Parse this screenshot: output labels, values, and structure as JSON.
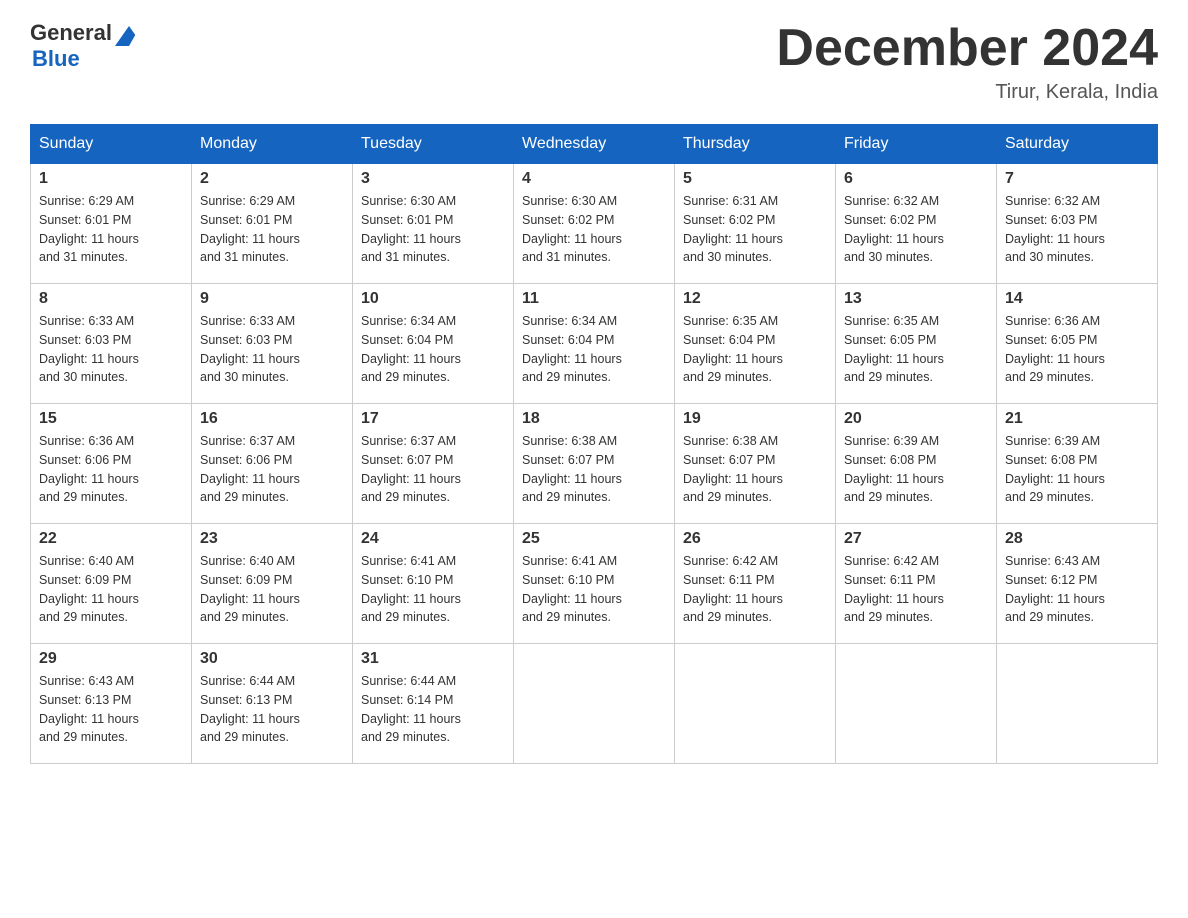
{
  "header": {
    "logo": {
      "general": "General",
      "blue": "Blue"
    },
    "title": "December 2024",
    "location": "Tirur, Kerala, India"
  },
  "days_of_week": [
    "Sunday",
    "Monday",
    "Tuesday",
    "Wednesday",
    "Thursday",
    "Friday",
    "Saturday"
  ],
  "weeks": [
    [
      {
        "day": "1",
        "sunrise": "6:29 AM",
        "sunset": "6:01 PM",
        "daylight": "11 hours and 31 minutes."
      },
      {
        "day": "2",
        "sunrise": "6:29 AM",
        "sunset": "6:01 PM",
        "daylight": "11 hours and 31 minutes."
      },
      {
        "day": "3",
        "sunrise": "6:30 AM",
        "sunset": "6:01 PM",
        "daylight": "11 hours and 31 minutes."
      },
      {
        "day": "4",
        "sunrise": "6:30 AM",
        "sunset": "6:02 PM",
        "daylight": "11 hours and 31 minutes."
      },
      {
        "day": "5",
        "sunrise": "6:31 AM",
        "sunset": "6:02 PM",
        "daylight": "11 hours and 30 minutes."
      },
      {
        "day": "6",
        "sunrise": "6:32 AM",
        "sunset": "6:02 PM",
        "daylight": "11 hours and 30 minutes."
      },
      {
        "day": "7",
        "sunrise": "6:32 AM",
        "sunset": "6:03 PM",
        "daylight": "11 hours and 30 minutes."
      }
    ],
    [
      {
        "day": "8",
        "sunrise": "6:33 AM",
        "sunset": "6:03 PM",
        "daylight": "11 hours and 30 minutes."
      },
      {
        "day": "9",
        "sunrise": "6:33 AM",
        "sunset": "6:03 PM",
        "daylight": "11 hours and 30 minutes."
      },
      {
        "day": "10",
        "sunrise": "6:34 AM",
        "sunset": "6:04 PM",
        "daylight": "11 hours and 29 minutes."
      },
      {
        "day": "11",
        "sunrise": "6:34 AM",
        "sunset": "6:04 PM",
        "daylight": "11 hours and 29 minutes."
      },
      {
        "day": "12",
        "sunrise": "6:35 AM",
        "sunset": "6:04 PM",
        "daylight": "11 hours and 29 minutes."
      },
      {
        "day": "13",
        "sunrise": "6:35 AM",
        "sunset": "6:05 PM",
        "daylight": "11 hours and 29 minutes."
      },
      {
        "day": "14",
        "sunrise": "6:36 AM",
        "sunset": "6:05 PM",
        "daylight": "11 hours and 29 minutes."
      }
    ],
    [
      {
        "day": "15",
        "sunrise": "6:36 AM",
        "sunset": "6:06 PM",
        "daylight": "11 hours and 29 minutes."
      },
      {
        "day": "16",
        "sunrise": "6:37 AM",
        "sunset": "6:06 PM",
        "daylight": "11 hours and 29 minutes."
      },
      {
        "day": "17",
        "sunrise": "6:37 AM",
        "sunset": "6:07 PM",
        "daylight": "11 hours and 29 minutes."
      },
      {
        "day": "18",
        "sunrise": "6:38 AM",
        "sunset": "6:07 PM",
        "daylight": "11 hours and 29 minutes."
      },
      {
        "day": "19",
        "sunrise": "6:38 AM",
        "sunset": "6:07 PM",
        "daylight": "11 hours and 29 minutes."
      },
      {
        "day": "20",
        "sunrise": "6:39 AM",
        "sunset": "6:08 PM",
        "daylight": "11 hours and 29 minutes."
      },
      {
        "day": "21",
        "sunrise": "6:39 AM",
        "sunset": "6:08 PM",
        "daylight": "11 hours and 29 minutes."
      }
    ],
    [
      {
        "day": "22",
        "sunrise": "6:40 AM",
        "sunset": "6:09 PM",
        "daylight": "11 hours and 29 minutes."
      },
      {
        "day": "23",
        "sunrise": "6:40 AM",
        "sunset": "6:09 PM",
        "daylight": "11 hours and 29 minutes."
      },
      {
        "day": "24",
        "sunrise": "6:41 AM",
        "sunset": "6:10 PM",
        "daylight": "11 hours and 29 minutes."
      },
      {
        "day": "25",
        "sunrise": "6:41 AM",
        "sunset": "6:10 PM",
        "daylight": "11 hours and 29 minutes."
      },
      {
        "day": "26",
        "sunrise": "6:42 AM",
        "sunset": "6:11 PM",
        "daylight": "11 hours and 29 minutes."
      },
      {
        "day": "27",
        "sunrise": "6:42 AM",
        "sunset": "6:11 PM",
        "daylight": "11 hours and 29 minutes."
      },
      {
        "day": "28",
        "sunrise": "6:43 AM",
        "sunset": "6:12 PM",
        "daylight": "11 hours and 29 minutes."
      }
    ],
    [
      {
        "day": "29",
        "sunrise": "6:43 AM",
        "sunset": "6:13 PM",
        "daylight": "11 hours and 29 minutes."
      },
      {
        "day": "30",
        "sunrise": "6:44 AM",
        "sunset": "6:13 PM",
        "daylight": "11 hours and 29 minutes."
      },
      {
        "day": "31",
        "sunrise": "6:44 AM",
        "sunset": "6:14 PM",
        "daylight": "11 hours and 29 minutes."
      },
      null,
      null,
      null,
      null
    ]
  ],
  "labels": {
    "sunrise": "Sunrise:",
    "sunset": "Sunset:",
    "daylight": "Daylight:"
  }
}
